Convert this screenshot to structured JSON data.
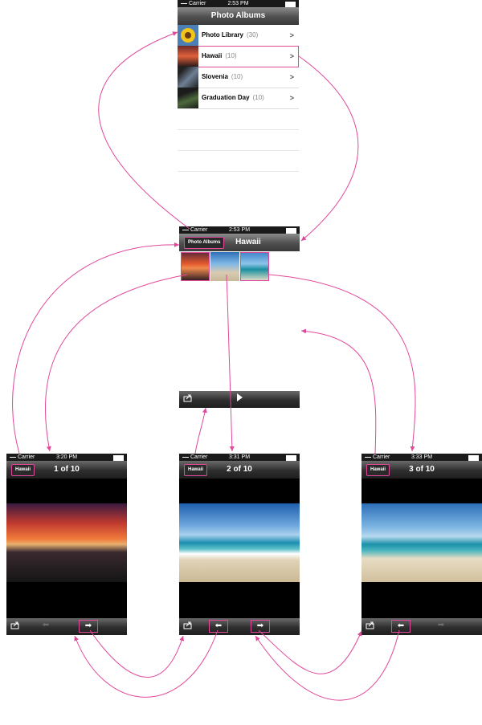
{
  "status": {
    "carrier": "Carrier",
    "time_albums": "2:53 PM",
    "time_hawaii": "2:53 PM",
    "time_photo1": "3:20 PM",
    "time_photo2": "3:31 PM",
    "time_photo3": "3:33 PM"
  },
  "albums_screen": {
    "title": "Photo Albums",
    "rows": [
      {
        "label": "Photo Library",
        "count": "(30)"
      },
      {
        "label": "Hawaii",
        "count": "(10)"
      },
      {
        "label": "Slovenia",
        "count": "(10)"
      },
      {
        "label": "Graduation Day",
        "count": "(10)"
      }
    ],
    "chevron": ">"
  },
  "hawaii_screen": {
    "back_label": "Photo Albums",
    "title": "Hawaii"
  },
  "photo_screens": [
    {
      "back_label": "Hawaii",
      "title": "1 of 10"
    },
    {
      "back_label": "Hawaii",
      "title": "2 of 10"
    },
    {
      "back_label": "Hawaii",
      "title": "3 of 10"
    }
  ],
  "icons": {
    "share": "share-icon",
    "play": "play-icon",
    "prev": "arrow-left-icon",
    "next": "arrow-right-icon"
  },
  "colors": {
    "arrow": "#e0489a",
    "navbar": "#4f4f4f"
  }
}
